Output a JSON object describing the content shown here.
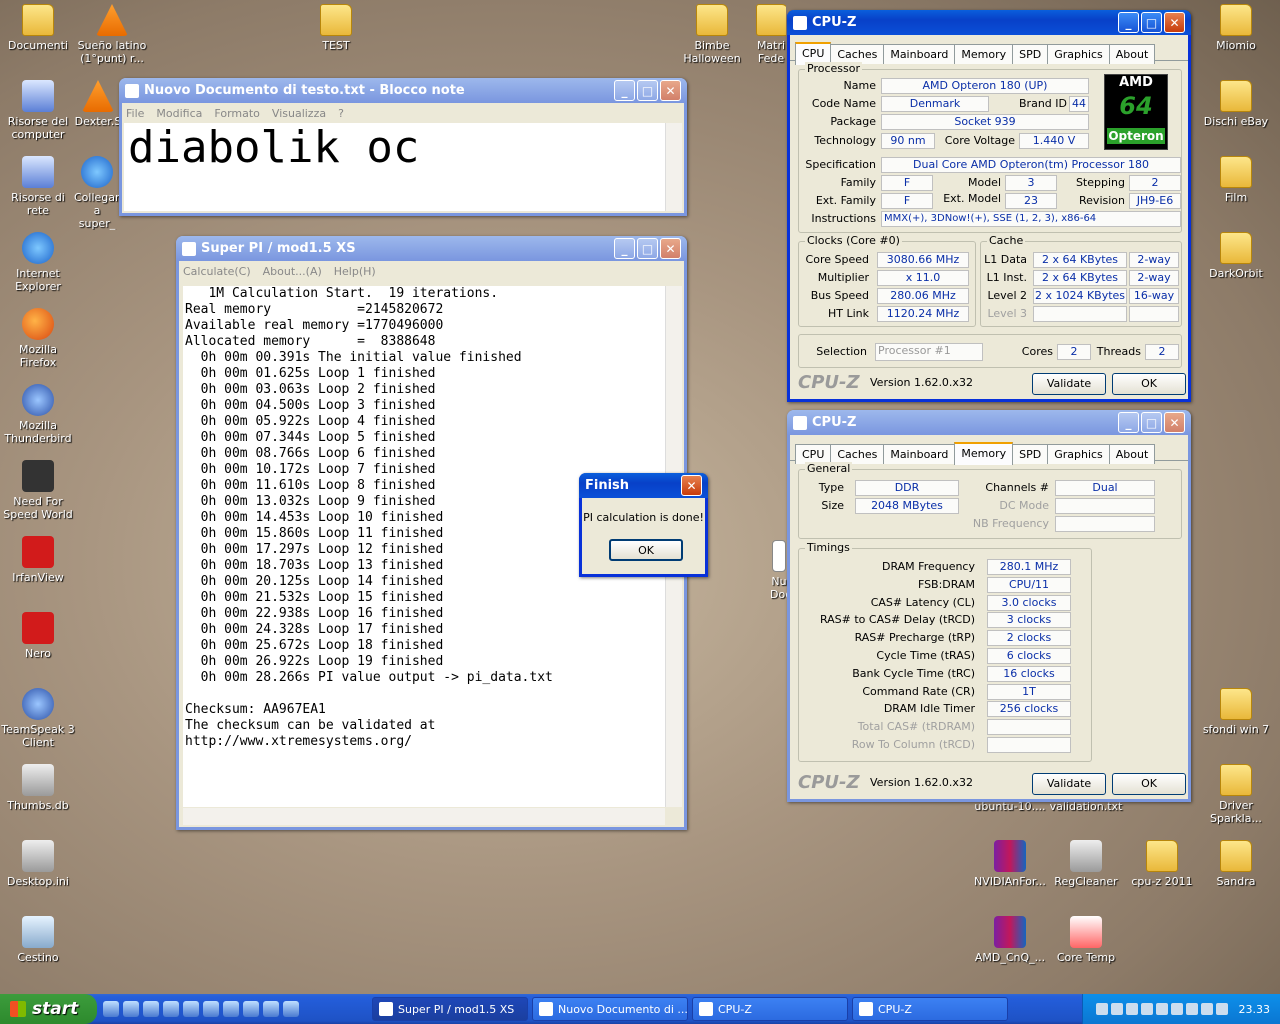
{
  "desktop": {
    "left_icons": [
      "Documenti",
      "Sueño latino (1°punt) r...",
      "Risorse del computer",
      "Dexter.S",
      "Risorse di rete",
      "Collegam a super_",
      "Internet Explorer",
      "Mozilla Firefox",
      "Mozilla Thunderbird",
      "Need For Speed World",
      "IrfanView",
      "Nero",
      "TeamSpeak 3 Client",
      "Thumbs.db",
      "Desktop.ini",
      "Cestino"
    ],
    "top_icons": [
      "TEST",
      "Bimbe Halloween",
      "Matri Fede"
    ],
    "right_icons": [
      "Miomio",
      "Dischi eBay",
      "Film",
      "DarkOrbit",
      "sfondi win 7",
      "Driver Sparkla...",
      "Sandra"
    ],
    "bottom_icons": [
      "NVIDIAnFor...",
      "RegCleaner",
      "cpu-z 2011",
      "AMD_CnQ_...",
      "Core Temp"
    ],
    "hidden_labels": [
      "ubuntu-10....",
      "validation.txt",
      "Nu Docum"
    ]
  },
  "notepad": {
    "title": "Nuovo Documento di testo.txt - Blocco note",
    "menu": [
      "File",
      "Modifica",
      "Formato",
      "Visualizza",
      "?"
    ],
    "content": "diabolik oc"
  },
  "superpi": {
    "title": "Super PI / mod1.5 XS",
    "menu": [
      "Calculate(C)",
      "About...(A)",
      "Help(H)"
    ],
    "lines": [
      "   1M Calculation Start.  19 iterations.",
      "Real memory           =2145820672",
      "Available real memory =1770496000",
      "Allocated memory      =  8388648",
      "  0h 00m 00.391s The initial value finished",
      "  0h 00m 01.625s Loop 1 finished",
      "  0h 00m 03.063s Loop 2 finished",
      "  0h 00m 04.500s Loop 3 finished",
      "  0h 00m 05.922s Loop 4 finished",
      "  0h 00m 07.344s Loop 5 finished",
      "  0h 00m 08.766s Loop 6 finished",
      "  0h 00m 10.172s Loop 7 finished",
      "  0h 00m 11.610s Loop 8 finished",
      "  0h 00m 13.032s Loop 9 finished",
      "  0h 00m 14.453s Loop 10 finished",
      "  0h 00m 15.860s Loop 11 finished",
      "  0h 00m 17.297s Loop 12 finished",
      "  0h 00m 18.703s Loop 13 finished",
      "  0h 00m 20.125s Loop 14 finished",
      "  0h 00m 21.532s Loop 15 finished",
      "  0h 00m 22.938s Loop 16 finished",
      "  0h 00m 24.328s Loop 17 finished",
      "  0h 00m 25.672s Loop 18 finished",
      "  0h 00m 26.922s Loop 19 finished",
      "  0h 00m 28.266s PI value output -> pi_data.txt",
      "",
      "Checksum: AA967EA1",
      "The checksum can be validated at",
      "http://www.xtremesystems.org/"
    ]
  },
  "finish_dialog": {
    "title": "Finish",
    "message": "PI calculation is done!",
    "ok": "OK"
  },
  "cpuz_cpu": {
    "title": "CPU-Z",
    "tabs": [
      "CPU",
      "Caches",
      "Mainboard",
      "Memory",
      "SPD",
      "Graphics",
      "About"
    ],
    "processor_group": "Processor",
    "name_label": "Name",
    "name": "AMD Opteron 180 (UP)",
    "codename_label": "Code Name",
    "codename": "Denmark",
    "brandid_label": "Brand ID",
    "brandid": "44",
    "package_label": "Package",
    "package": "Socket 939",
    "technology_label": "Technology",
    "technology": "90 nm",
    "voltage_label": "Core Voltage",
    "voltage": "1.440 V",
    "spec_label": "Specification",
    "spec": "Dual Core AMD Opteron(tm) Processor 180",
    "family_label": "Family",
    "family": "F",
    "model_label": "Model",
    "model": "3",
    "stepping_label": "Stepping",
    "stepping": "2",
    "extfamily_label": "Ext. Family",
    "extfamily": "F",
    "extmodel_label": "Ext. Model",
    "extmodel": "23",
    "revision_label": "Revision",
    "revision": "JH9-E6",
    "instr_label": "Instructions",
    "instr": "MMX(+), 3DNow!(+), SSE (1, 2, 3), x86-64",
    "logo_top": "AMD",
    "logo_mid": "64",
    "logo_bot": "Opteron",
    "clocks_group": "Clocks (Core #0)",
    "corespeed_label": "Core Speed",
    "corespeed": "3080.66 MHz",
    "multiplier_label": "Multiplier",
    "multiplier": "x 11.0",
    "busspeed_label": "Bus Speed",
    "busspeed": "280.06 MHz",
    "htlink_label": "HT Link",
    "htlink": "1120.24 MHz",
    "cache_group": "Cache",
    "l1d_label": "L1 Data",
    "l1d": "2 x 64 KBytes",
    "l1d_way": "2-way",
    "l1i_label": "L1 Inst.",
    "l1i": "2 x 64 KBytes",
    "l1i_way": "2-way",
    "l2_label": "Level 2",
    "l2": "2 x 1024 KBytes",
    "l2_way": "16-way",
    "l3_label": "Level 3",
    "selection_label": "Selection",
    "selection": "Processor #1",
    "cores_label": "Cores",
    "cores": "2",
    "threads_label": "Threads",
    "threads": "2",
    "brand": "CPU-Z",
    "version": "Version 1.62.0.x32",
    "validate": "Validate",
    "ok": "OK"
  },
  "cpuz_mem": {
    "title": "CPU-Z",
    "general_group": "General",
    "type_label": "Type",
    "type": "DDR",
    "size_label": "Size",
    "size": "2048 MBytes",
    "channels_label": "Channels #",
    "channels": "Dual",
    "dcmode_label": "DC Mode",
    "nbfreq_label": "NB Frequency",
    "timings_group": "Timings",
    "timings": [
      {
        "label": "DRAM Frequency",
        "value": "280.1 MHz"
      },
      {
        "label": "FSB:DRAM",
        "value": "CPU/11"
      },
      {
        "label": "CAS# Latency (CL)",
        "value": "3.0 clocks"
      },
      {
        "label": "RAS# to CAS# Delay (tRCD)",
        "value": "3 clocks"
      },
      {
        "label": "RAS# Precharge (tRP)",
        "value": "2 clocks"
      },
      {
        "label": "Cycle Time (tRAS)",
        "value": "6 clocks"
      },
      {
        "label": "Bank Cycle Time (tRC)",
        "value": "16 clocks"
      },
      {
        "label": "Command Rate (CR)",
        "value": "1T"
      },
      {
        "label": "DRAM Idle Timer",
        "value": "256 clocks"
      },
      {
        "label": "Total CAS# (tRDRAM)",
        "value": ""
      },
      {
        "label": "Row To Column (tRCD)",
        "value": ""
      }
    ]
  },
  "taskbar": {
    "start": "start",
    "tasks": [
      "Super PI / mod1.5 XS",
      "Nuovo Documento di ...",
      "CPU-Z",
      "CPU-Z"
    ],
    "clock": "23.33"
  }
}
